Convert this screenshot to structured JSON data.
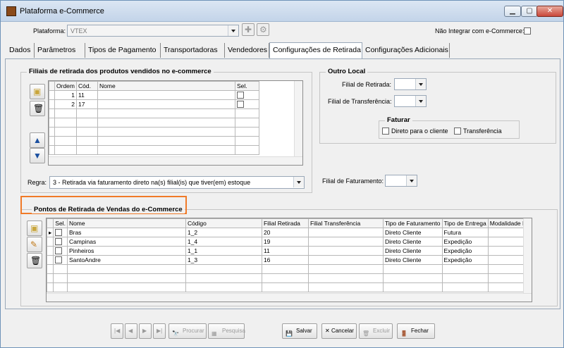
{
  "window": {
    "title": "Plataforma e-Commerce"
  },
  "header": {
    "plataforma_label": "Plataforma:",
    "plataforma_value": "VTEX",
    "nao_integrar_label": "Não Integrar com e-Commerce:"
  },
  "tabs": [
    {
      "label": "Dados"
    },
    {
      "label": "Parâmetros"
    },
    {
      "label": "Tipos de Pagamento"
    },
    {
      "label": "Transportadoras"
    },
    {
      "label": "Vendedores"
    },
    {
      "label": "Configurações de Retirada"
    },
    {
      "label": "Configurações Adicionais"
    }
  ],
  "filiais": {
    "title": "Filiais de retirada dos produtos vendidos no e-commerce",
    "columns": [
      "Ordem",
      "Cód.",
      "Nome",
      "Sel."
    ],
    "rows": [
      {
        "ordem": "1",
        "cod": "11",
        "nome": ""
      },
      {
        "ordem": "2",
        "cod": "17",
        "nome": ""
      }
    ],
    "regra_label": "Regra:",
    "regra_value": "3 - Retirada via faturamento direto na(s) filial(is) que tiver(em) estoque"
  },
  "outro_local": {
    "title": "Outro Local",
    "filial_retirada_label": "Filial de Retirada:",
    "filial_transferencia_label": "Filial de Transferência:",
    "faturar_title": "Faturar",
    "direto_label": "Direto para o cliente",
    "transferencia_label": "Transferência"
  },
  "filial_faturamento_label": "Filial de Faturamento:",
  "pontos": {
    "title": "Pontos de Retirada de Vendas do e-Commerce",
    "columns": [
      "Sel.",
      "Nome",
      "Código",
      "Filial Retirada",
      "Filial Transferência",
      "Tipo de Faturamento",
      "Tipo de Entrega",
      "Modalidade E"
    ],
    "rows": [
      {
        "nome": "Bras",
        "codigo": "1_2",
        "filial_retirada": "20",
        "filial_transferencia": "",
        "tipo_faturamento": "Direto Cliente",
        "tipo_entrega": "Futura",
        "modalidade": ""
      },
      {
        "nome": "Campinas",
        "codigo": "1_4",
        "filial_retirada": "19",
        "filial_transferencia": "",
        "tipo_faturamento": "Direto Cliente",
        "tipo_entrega": "Expedição",
        "modalidade": ""
      },
      {
        "nome": "Pinheiros",
        "codigo": "1_1",
        "filial_retirada": "11",
        "filial_transferencia": "",
        "tipo_faturamento": "Direto Cliente",
        "tipo_entrega": "Expedição",
        "modalidade": ""
      },
      {
        "nome": "SantoAndre",
        "codigo": "1_3",
        "filial_retirada": "16",
        "filial_transferencia": "",
        "tipo_faturamento": "Direto Cliente",
        "tipo_entrega": "Expedição",
        "modalidade": ""
      }
    ]
  },
  "footer": {
    "procurar": "Procurar",
    "pesquisa": "Pesquisa",
    "salvar": "Salvar",
    "cancelar": "Cancelar",
    "excluir": "Excluir",
    "fechar": "Fechar"
  }
}
